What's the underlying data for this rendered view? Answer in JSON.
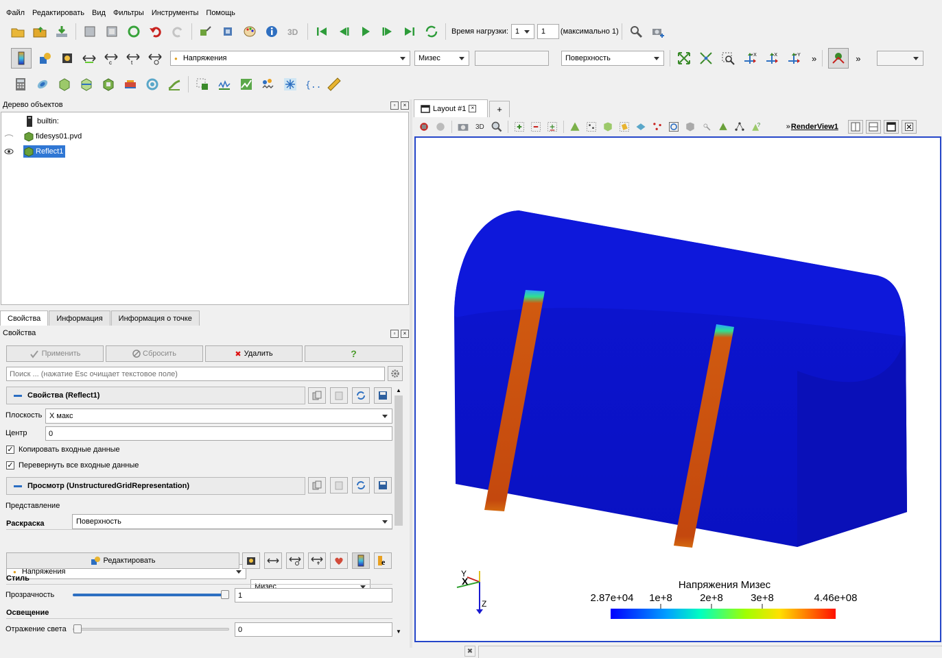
{
  "menu": [
    "Файл",
    "Редактировать",
    "Вид",
    "Фильтры",
    "Инструменты",
    "Помощь"
  ],
  "toolbar1": {
    "time_label": "Время нагрузки:",
    "time_value": "1",
    "time_spin": "1",
    "time_max": "(максимально 1)"
  },
  "toolbar2": {
    "array_combo": "Напряжения",
    "component_combo": "Мизес",
    "representation_combo": "Поверхность",
    "more": "»"
  },
  "pipeline": {
    "title": "Дерево объектов",
    "items": [
      {
        "label": "builtin:"
      },
      {
        "label": "fidesys01.pvd"
      },
      {
        "label": "Reflect1"
      }
    ]
  },
  "tabs": [
    "Свойства",
    "Информация",
    "Информация о точке"
  ],
  "properties": {
    "title": "Свойства",
    "apply": "Применить",
    "reset": "Сбросить",
    "delete": "Удалить",
    "help": "?",
    "search_placeholder": "Поиск ... (нажатие Esc очищает текстовое поле)",
    "section1": "Свойства (Reflect1)",
    "plane_label": "Плоскость",
    "plane_value": "X макс",
    "center_label": "Центр",
    "center_value": "0",
    "copy_input": "Копировать входные данные",
    "flip_all": "Перевернуть все входные данные",
    "section2": "Просмотр (UnstructuredGridRepresentation)",
    "repr_label": "Представление",
    "repr_value": "Поверхность",
    "coloring_label": "Раскраска",
    "color_array": "Напряжения",
    "color_comp": "Мизес",
    "edit_button": "Редактировать",
    "style_label": "Стиль",
    "opacity_label": "Прозрачность",
    "opacity_value": "1",
    "lighting_label": "Освещение",
    "specular_label": "Отражение света",
    "specular_value": "0"
  },
  "layout": {
    "tab": "Layout #1",
    "add": "+",
    "view_name": "RenderView1",
    "btn_3d": "3D"
  },
  "render": {
    "legend_title": "Напряжения Мизес",
    "ticks": [
      "2.87e+04",
      "1e+8",
      "2e+8",
      "3e+8",
      "4.46e+08"
    ],
    "axes": {
      "y": "Y",
      "x": "X",
      "z": "Z"
    }
  },
  "colors": {
    "body": "#0a10c8",
    "strap": "#c4480e",
    "selection": "#3077d4"
  }
}
